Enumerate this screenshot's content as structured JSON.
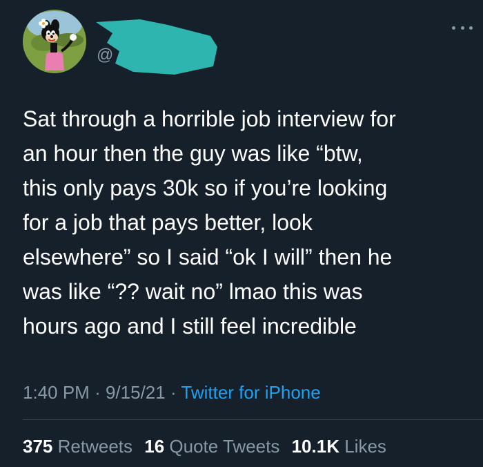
{
  "tweet": {
    "handle_prefix": "@",
    "text": "Sat through a horrible job interview for\nan hour then the guy was like “btw,\nthis only pays 30k so if you’re looking\nfor a job that pays better, look\nelsewhere” so I said “ok I will” then he\nwas like “?? wait no” lmao this was\nhours ago and I still feel incredible",
    "time": "1:40 PM",
    "date": "9/15/21",
    "separator": "·",
    "source": "Twitter for iPhone"
  },
  "stats": {
    "retweets_count": "375",
    "retweets_label": "Retweets",
    "quotes_count": "16",
    "quotes_label": "Quote Tweets",
    "likes_count": "10.1K",
    "likes_label": "Likes"
  },
  "icons": {
    "more": "more-options-icon",
    "avatar": "cartoon-avatar"
  },
  "colors": {
    "background": "#15202b",
    "text": "#ffffff",
    "secondary": "#8899a6",
    "link": "#1da1f2",
    "redaction": "#2fb5b0"
  }
}
